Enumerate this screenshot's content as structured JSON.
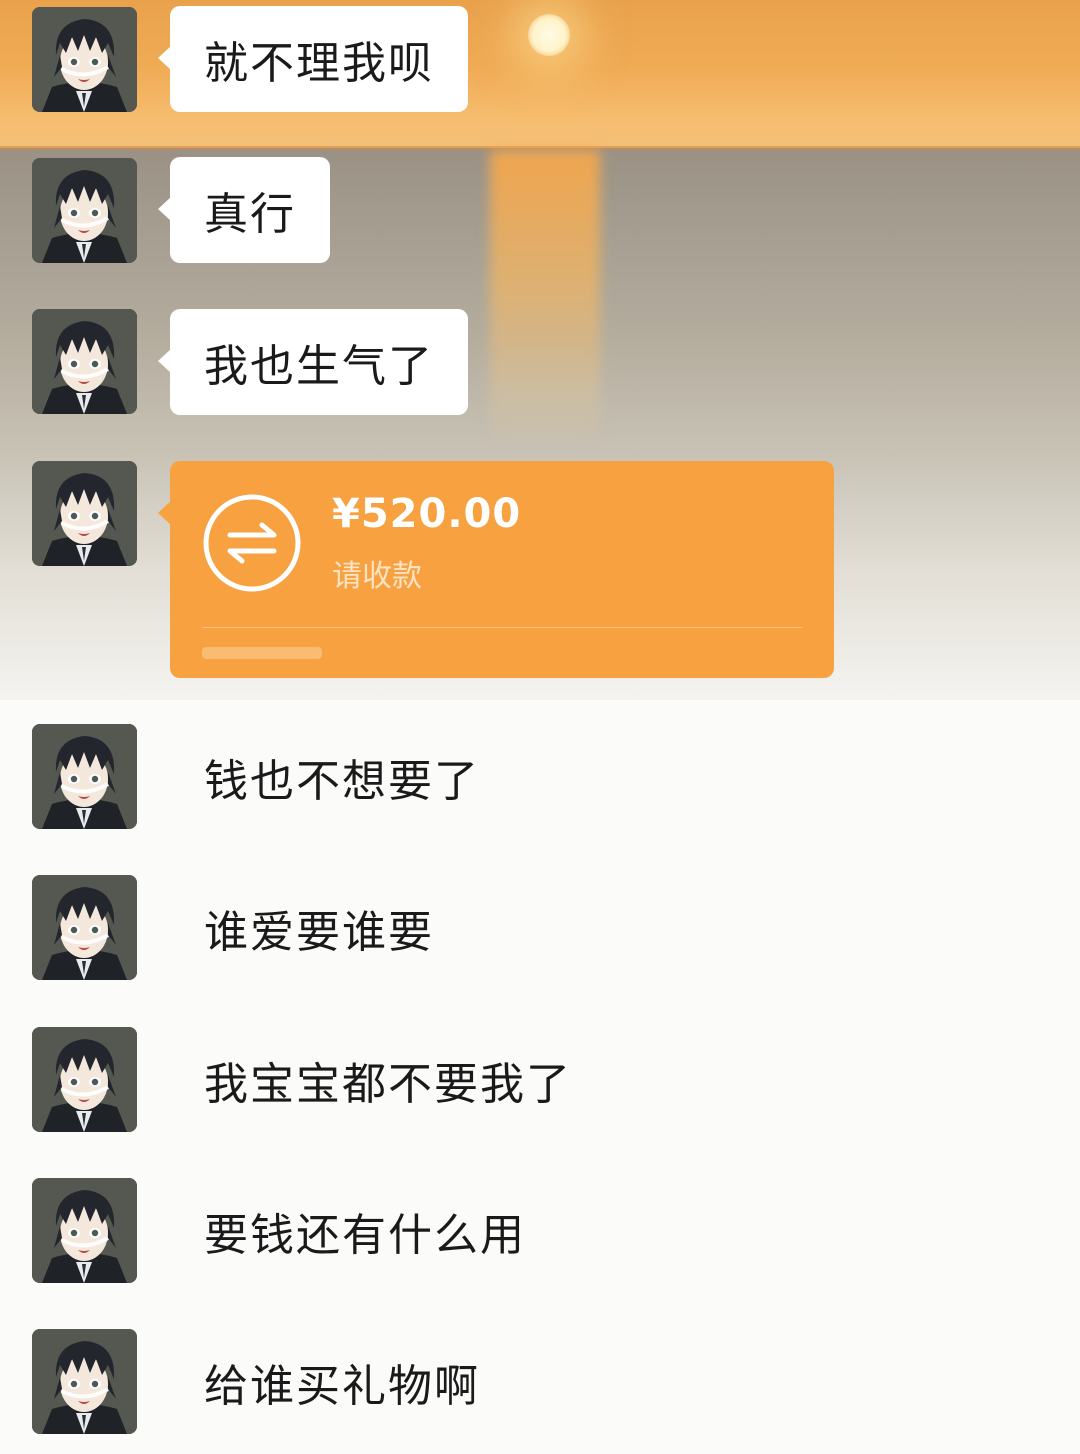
{
  "messages": [
    {
      "text": "就不理我呗"
    },
    {
      "text": "真行"
    },
    {
      "text": "我也生气了"
    },
    {
      "text": "钱也不想要了"
    },
    {
      "text": "谁爱要谁要"
    },
    {
      "text": "我宝宝都不要我了"
    },
    {
      "text": "要钱还有什么用"
    },
    {
      "text": "给谁买礼物啊"
    }
  ],
  "transfer": {
    "amount": "¥520.00",
    "status": "请收款",
    "icon": "transfer-arrows-icon",
    "color": "#f7a141"
  },
  "avatar": {
    "icon": "anime-boy-avatar"
  }
}
